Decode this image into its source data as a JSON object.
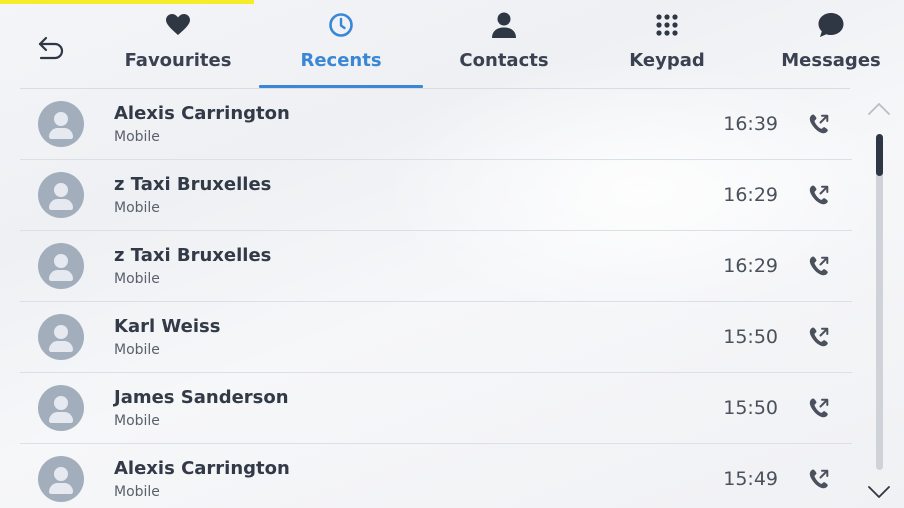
{
  "header": {
    "back_icon": "back-arrow-icon",
    "tabs": [
      {
        "label": "Favourites",
        "icon": "heart-icon",
        "active": false
      },
      {
        "label": "Recents",
        "icon": "clock-icon",
        "active": true
      },
      {
        "label": "Contacts",
        "icon": "person-icon",
        "active": false
      },
      {
        "label": "Keypad",
        "icon": "keypad-icon",
        "active": false
      },
      {
        "label": "Messages",
        "icon": "chat-bubble-icon",
        "active": false
      }
    ]
  },
  "colors": {
    "accent": "#3a87d6",
    "text_dark": "#323a47",
    "avatar_bg": "#a3aebd"
  },
  "recents": [
    {
      "name": "Alexis Carrington",
      "type": "Mobile",
      "time": "16:39",
      "call_icon": "outgoing-call-icon"
    },
    {
      "name": "z Taxi Bruxelles",
      "type": "Mobile",
      "time": "16:29",
      "call_icon": "outgoing-call-icon"
    },
    {
      "name": "z Taxi Bruxelles",
      "type": "Mobile",
      "time": "16:29",
      "call_icon": "outgoing-call-icon"
    },
    {
      "name": "Karl Weiss",
      "type": "Mobile",
      "time": "15:50",
      "call_icon": "outgoing-call-icon"
    },
    {
      "name": "James Sanderson",
      "type": "Mobile",
      "time": "15:50",
      "call_icon": "outgoing-call-icon"
    },
    {
      "name": "Alexis Carrington",
      "type": "Mobile",
      "time": "15:49",
      "call_icon": "outgoing-call-icon"
    }
  ]
}
